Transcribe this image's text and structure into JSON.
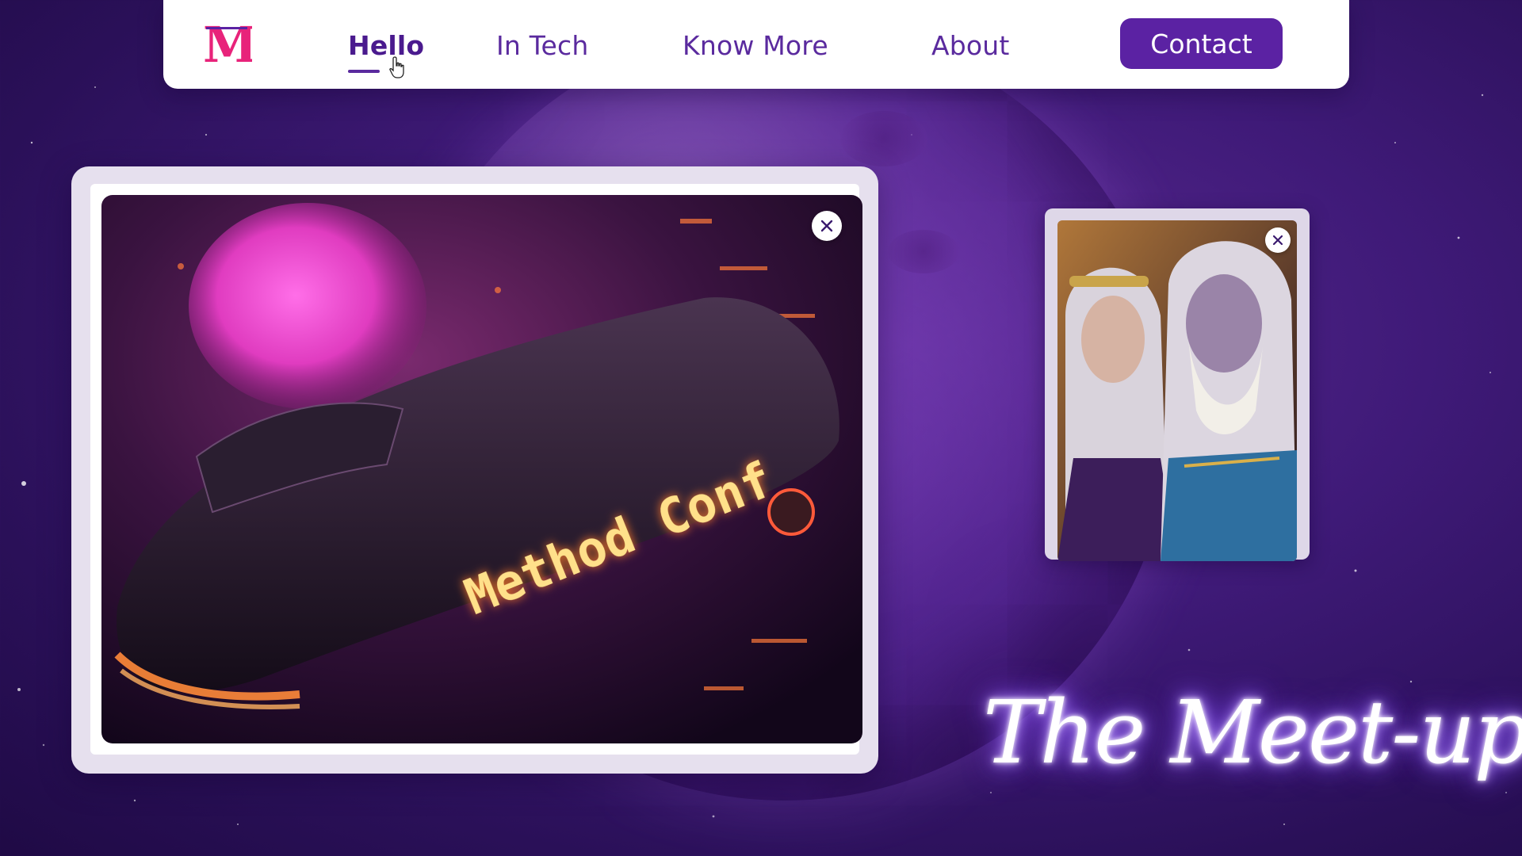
{
  "nav": {
    "logo_text": "M",
    "links": [
      "Hello",
      "In Tech",
      "Know More",
      "About"
    ],
    "active_index": 0,
    "contact_label": "Contact"
  },
  "cards": {
    "large": {
      "overlay_text": "Method Conf",
      "close_symbol": "×"
    },
    "small": {
      "close_symbol": "×"
    }
  },
  "headline": "The Meet-up",
  "colors": {
    "brand_purple": "#5b22a3",
    "nav_text": "#5a2a9e",
    "logo_pink": "#e8237a",
    "background": "#3f1a78"
  },
  "icons": [
    "logo-m-icon",
    "hand-cursor-icon",
    "close-icon"
  ]
}
